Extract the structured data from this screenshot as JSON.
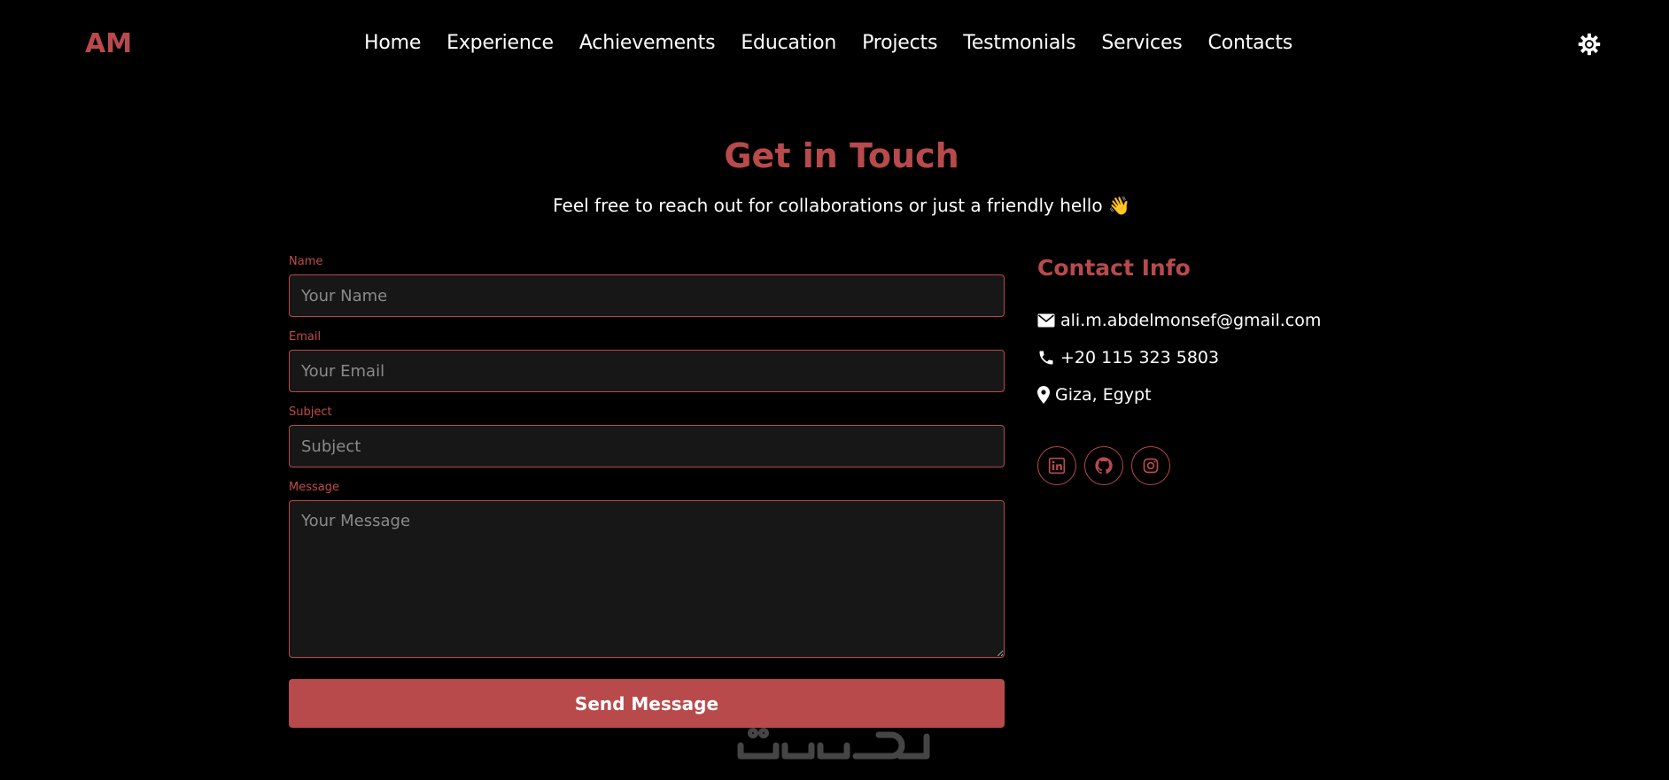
{
  "logo": "AM",
  "nav": {
    "items": [
      "Home",
      "Experience",
      "Achievements",
      "Education",
      "Projects",
      "Testmonials",
      "Services",
      "Contacts"
    ],
    "theme_icon": "gear-icon"
  },
  "header": {
    "title": "Get in Touch",
    "subtitle": "Feel free to reach out for collaborations or just a friendly hello",
    "emoji": "👋"
  },
  "form": {
    "name_label": "Name",
    "name_placeholder": "Your Name",
    "email_label": "Email",
    "email_placeholder": "Your Email",
    "subject_label": "Subject",
    "subject_placeholder": "Subject",
    "message_label": "Message",
    "message_placeholder": "Your Message",
    "submit_label": "Send Message"
  },
  "contact_info": {
    "title": "Contact Info",
    "email": "ali.m.abdelmonsef@gmail.com",
    "phone": "+20 115 323 5803",
    "location": "Giza, Egypt",
    "socials": [
      "linkedin-icon",
      "github-icon",
      "instagram-icon"
    ]
  },
  "watermark": "خمسات",
  "colors": {
    "accent": "#b84a4c",
    "background": "#000000",
    "input_bg": "#171717"
  }
}
